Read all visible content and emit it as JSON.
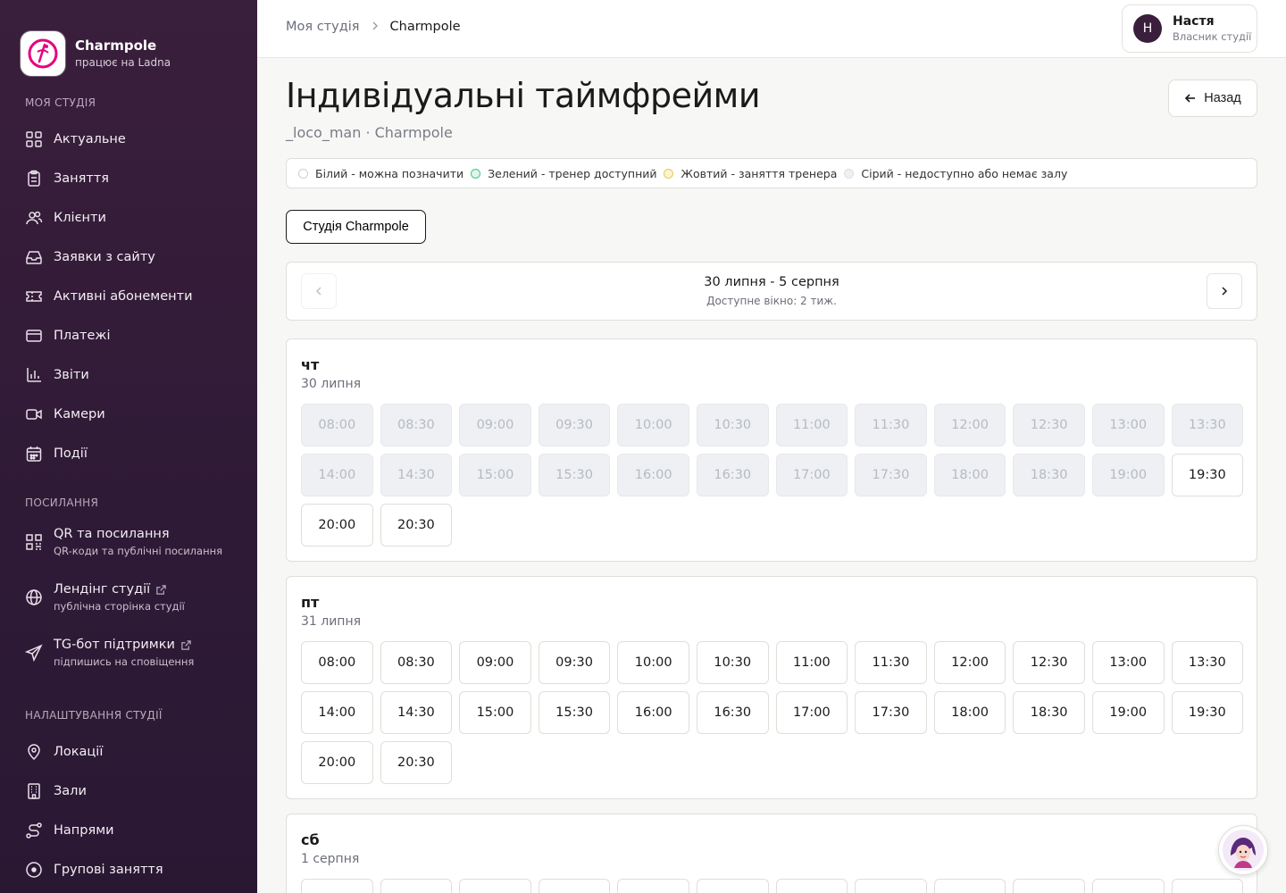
{
  "brand": {
    "name": "Charmpole",
    "sub": "працює на Ladna"
  },
  "sidebar": {
    "sections": [
      {
        "title": "Моя студія",
        "items": [
          {
            "label": "Актуальне",
            "icon": "dashboard-icon"
          },
          {
            "label": "Заняття",
            "icon": "clipboard-icon"
          },
          {
            "label": "Клієнти",
            "icon": "users-icon"
          },
          {
            "label": "Заявки з сайту",
            "icon": "inbox-icon"
          },
          {
            "label": "Активні абонементи",
            "icon": "ticket-icon"
          },
          {
            "label": "Платежі",
            "icon": "credit-card-icon"
          },
          {
            "label": "Звіти",
            "icon": "bar-chart-icon"
          },
          {
            "label": "Камери",
            "icon": "video-icon"
          },
          {
            "label": "Події",
            "icon": "calendar-icon"
          }
        ]
      },
      {
        "title": "Посилання",
        "items": [
          {
            "label": "QR та посилання",
            "sub": "QR-коди та публічні посилання",
            "icon": "qr-icon"
          },
          {
            "label": "Лендінг студії",
            "sub": "публічна сторінка студії",
            "icon": "globe-icon"
          },
          {
            "label": "TG-бот підтримки",
            "sub": "підпишись на сповіщення",
            "icon": "send-icon"
          }
        ]
      },
      {
        "title": "Налаштування студії",
        "items": [
          {
            "label": "Локації",
            "icon": "map-pin-icon"
          },
          {
            "label": "Зали",
            "icon": "building-icon"
          },
          {
            "label": "Напрями",
            "icon": "route-icon"
          },
          {
            "label": "Групові заняття",
            "icon": "circle-icon"
          }
        ]
      }
    ]
  },
  "topbar": {
    "breadcrumb": [
      "Моя студія",
      "Charmpole"
    ],
    "user": {
      "initial": "Н",
      "name": "Настя",
      "role": "Власник студії"
    }
  },
  "page": {
    "title": "Індивідуальні таймфрейми",
    "subtitle": "_loco_man · Charmpole",
    "back_label": "Назад"
  },
  "legend": [
    {
      "label": "Білий - можна позначити",
      "color": "#ffffff"
    },
    {
      "label": "Зелений - тренер доступний",
      "color": "#dff5ea"
    },
    {
      "label": "Жовтий - заняття тренера",
      "color": "#fdf3d0"
    },
    {
      "label": "Сірий - недоступно або немає залу",
      "color": "#eef0f3"
    }
  ],
  "studio_tab": "Студія Charmpole",
  "week": {
    "range": "30 липня - 5 серпня",
    "window": "Доступне вікно: 2 тиж."
  },
  "days": [
    {
      "name": "чт",
      "date": "30 липня",
      "slots": [
        {
          "t": "08:00",
          "s": "gray"
        },
        {
          "t": "08:30",
          "s": "gray"
        },
        {
          "t": "09:00",
          "s": "gray"
        },
        {
          "t": "09:30",
          "s": "gray"
        },
        {
          "t": "10:00",
          "s": "gray"
        },
        {
          "t": "10:30",
          "s": "gray"
        },
        {
          "t": "11:00",
          "s": "gray"
        },
        {
          "t": "11:30",
          "s": "gray"
        },
        {
          "t": "12:00",
          "s": "gray"
        },
        {
          "t": "12:30",
          "s": "gray"
        },
        {
          "t": "13:00",
          "s": "gray"
        },
        {
          "t": "13:30",
          "s": "gray"
        },
        {
          "t": "14:00",
          "s": "gray"
        },
        {
          "t": "14:30",
          "s": "gray"
        },
        {
          "t": "15:00",
          "s": "gray"
        },
        {
          "t": "15:30",
          "s": "gray"
        },
        {
          "t": "16:00",
          "s": "gray"
        },
        {
          "t": "16:30",
          "s": "gray"
        },
        {
          "t": "17:00",
          "s": "gray"
        },
        {
          "t": "17:30",
          "s": "gray"
        },
        {
          "t": "18:00",
          "s": "gray"
        },
        {
          "t": "18:30",
          "s": "gray"
        },
        {
          "t": "19:00",
          "s": "gray"
        },
        {
          "t": "19:30",
          "s": "white"
        },
        {
          "t": "20:00",
          "s": "white"
        },
        {
          "t": "20:30",
          "s": "white"
        }
      ]
    },
    {
      "name": "пт",
      "date": "31 липня",
      "slots": [
        {
          "t": "08:00",
          "s": "white"
        },
        {
          "t": "08:30",
          "s": "white"
        },
        {
          "t": "09:00",
          "s": "white"
        },
        {
          "t": "09:30",
          "s": "white"
        },
        {
          "t": "10:00",
          "s": "white"
        },
        {
          "t": "10:30",
          "s": "white"
        },
        {
          "t": "11:00",
          "s": "white"
        },
        {
          "t": "11:30",
          "s": "white"
        },
        {
          "t": "12:00",
          "s": "white"
        },
        {
          "t": "12:30",
          "s": "white"
        },
        {
          "t": "13:00",
          "s": "white"
        },
        {
          "t": "13:30",
          "s": "white"
        },
        {
          "t": "14:00",
          "s": "white"
        },
        {
          "t": "14:30",
          "s": "white"
        },
        {
          "t": "15:00",
          "s": "white"
        },
        {
          "t": "15:30",
          "s": "white"
        },
        {
          "t": "16:00",
          "s": "white"
        },
        {
          "t": "16:30",
          "s": "white"
        },
        {
          "t": "17:00",
          "s": "white"
        },
        {
          "t": "17:30",
          "s": "white"
        },
        {
          "t": "18:00",
          "s": "white"
        },
        {
          "t": "18:30",
          "s": "white"
        },
        {
          "t": "19:00",
          "s": "white"
        },
        {
          "t": "19:30",
          "s": "white"
        },
        {
          "t": "20:00",
          "s": "white"
        },
        {
          "t": "20:30",
          "s": "white"
        }
      ]
    },
    {
      "name": "сб",
      "date": "1 серпня",
      "slots": []
    }
  ]
}
